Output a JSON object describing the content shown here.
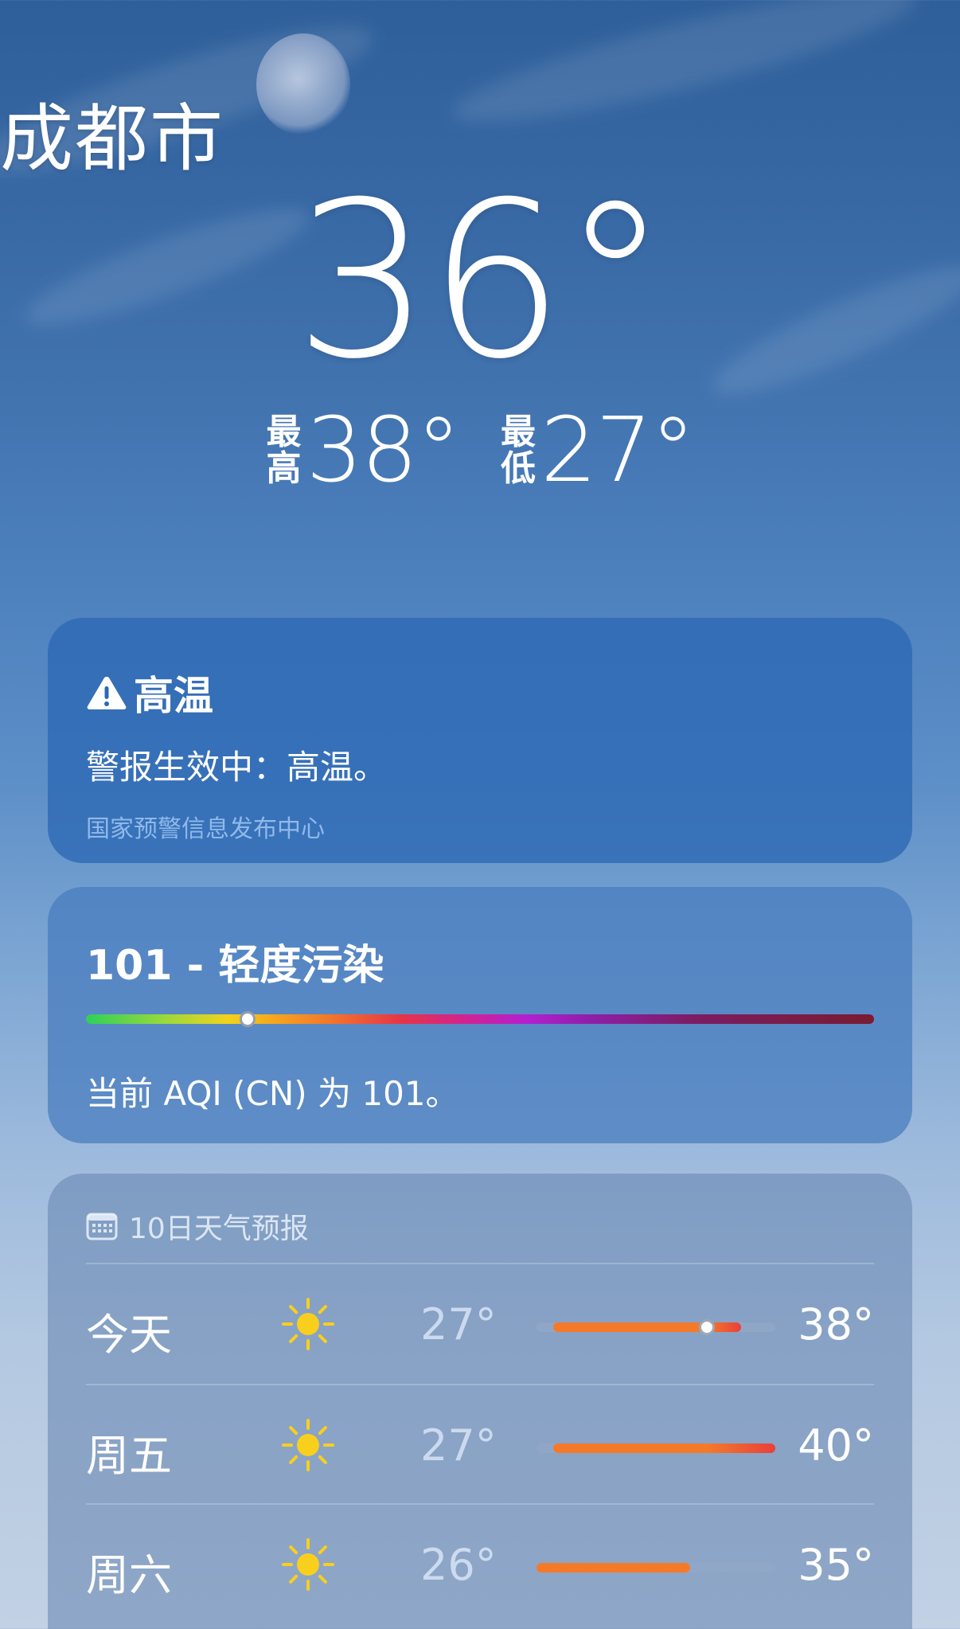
{
  "location": {
    "city": "成都市"
  },
  "current": {
    "temperature": "36°",
    "high_label": "最高",
    "high_label_chars": [
      "最",
      "高"
    ],
    "high_value": "38°",
    "low_label": "最低",
    "low_label_chars": [
      "最",
      "低"
    ],
    "low_value": "27°"
  },
  "alert": {
    "title": "高温",
    "message": "警报生效中：高温。",
    "source": "国家预警信息发布中心",
    "icon": "warning-triangle-icon"
  },
  "aqi": {
    "title": "101 - 轻度污染",
    "description": "当前 AQI (CN) 为 101。",
    "value": 101,
    "position_fraction": 0.205
  },
  "forecast": {
    "header": "10日天气预报",
    "icon": "calendar-icon",
    "range_min": 26,
    "range_max": 40,
    "days": [
      {
        "day": "今天",
        "icon": "sun-icon",
        "low": "27°",
        "high": "38°",
        "low_num": 27,
        "high_num": 38,
        "current_num": 36
      },
      {
        "day": "周五",
        "icon": "sun-icon",
        "low": "27°",
        "high": "40°",
        "low_num": 27,
        "high_num": 40
      },
      {
        "day": "周六",
        "icon": "sun-icon",
        "low": "26°",
        "high": "35°",
        "low_num": 26,
        "high_num": 35
      }
    ]
  },
  "colors": {
    "sky_top": "#2f5f9a",
    "sky_bottom": "#c2d1e4",
    "alert_card": "#2c68b4",
    "sun_yellow": "#f8cf1d",
    "range_orange": "#f47a2a",
    "range_red": "#e8403a"
  }
}
